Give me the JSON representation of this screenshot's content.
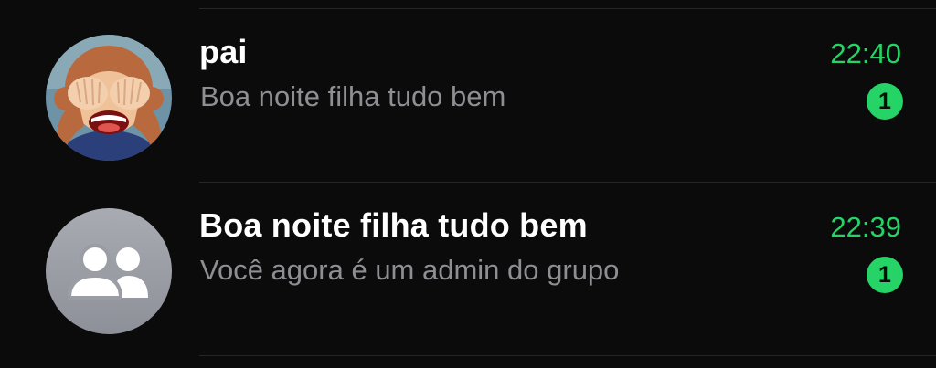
{
  "chats": [
    {
      "name": "pai",
      "preview": "Boa noite filha tudo bem",
      "time": "22:40",
      "unread": "1",
      "avatar_icon": "see-no-evil-monkey-memoji"
    },
    {
      "name": "Boa noite filha tudo bem",
      "preview": "Você agora é um admin do grupo",
      "time": "22:39",
      "unread": "1",
      "avatar_icon": "group-icon"
    }
  ],
  "colors": {
    "background": "#0b0b0b",
    "accent_green": "#25d366",
    "title": "#ffffff",
    "subtitle": "#8e8e93",
    "divider": "#262626"
  }
}
